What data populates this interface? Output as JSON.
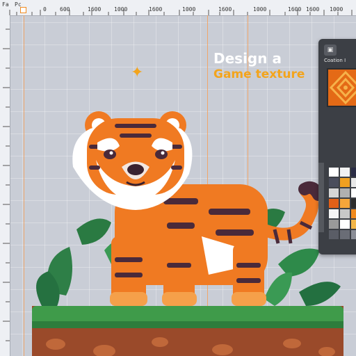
{
  "ruler": {
    "corner_labels": [
      "Fa",
      "Pc"
    ],
    "tick_labels": [
      "0",
      "600",
      "1600",
      "1000",
      "1600",
      "1000",
      "1600",
      "1000",
      "1600",
      "1600",
      "1000"
    ]
  },
  "heading": {
    "line1": "Design a",
    "line2": "Game texture"
  },
  "panel": {
    "title": "Coation I",
    "toolbar_icon": "image-icon"
  },
  "colors": {
    "accent_orange": "#f3a41c",
    "guide": "#f0a66a",
    "panel_bg": "#3c3f45",
    "tiger_orange": "#f07a22",
    "grass": "#3f9b4a",
    "dirt": "#9a4a2a"
  },
  "swatches": [
    "#ffffff",
    "#f2f2f2",
    "#2a2c45",
    "#4a4d5c",
    "#f0a020",
    "#e8e8e8",
    "#d6d6d6",
    "#b0b0b0",
    "#ffffff",
    "#e26018",
    "#f6a63a",
    "#2c2c2c",
    "#f5f5f5",
    "#c8c8c8",
    "#f08a1e",
    "#9a9a9a",
    "#ffffff",
    "#f2b64a",
    "#5a5d66",
    "#6a6d76",
    "#8a8d96"
  ]
}
